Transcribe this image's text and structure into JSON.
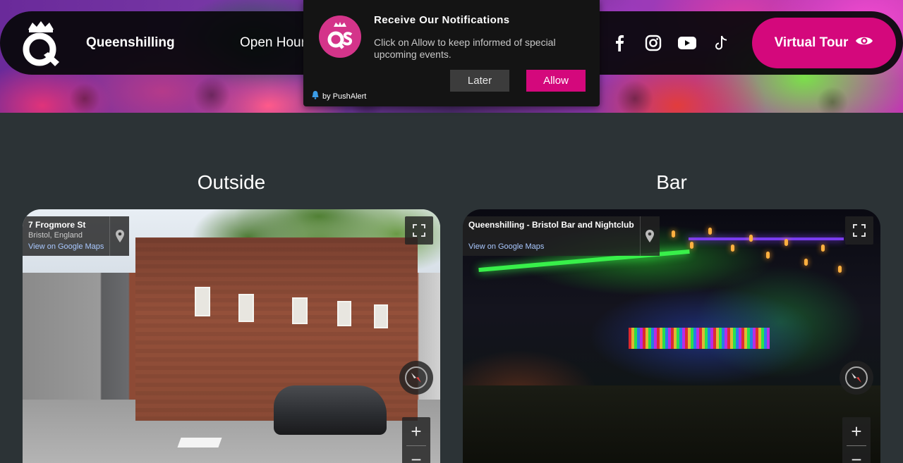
{
  "nav": {
    "brand": "Queenshilling",
    "open_hours": "Open Hours",
    "virtual_tour": "Virtual Tour",
    "social_icons": [
      "facebook-icon",
      "instagram-icon",
      "youtube-icon",
      "tiktok-icon"
    ]
  },
  "notification": {
    "title": "Receive Our Notifications",
    "body": "Click on Allow to keep informed of special upcoming events.",
    "later": "Later",
    "allow": "Allow",
    "powered_by": "by PushAlert"
  },
  "sections": [
    {
      "title": "Outside",
      "address": "7 Frogmore St",
      "subtitle": "Bristol, England",
      "maps_link": "View on Google Maps"
    },
    {
      "title": "Bar",
      "address": "Queenshilling - Bristol Bar and Nightclub",
      "maps_link": "View on Google Maps"
    }
  ],
  "colors": {
    "accent": "#d4087c",
    "background": "#2c3336",
    "nav_bg": "#08080a"
  }
}
